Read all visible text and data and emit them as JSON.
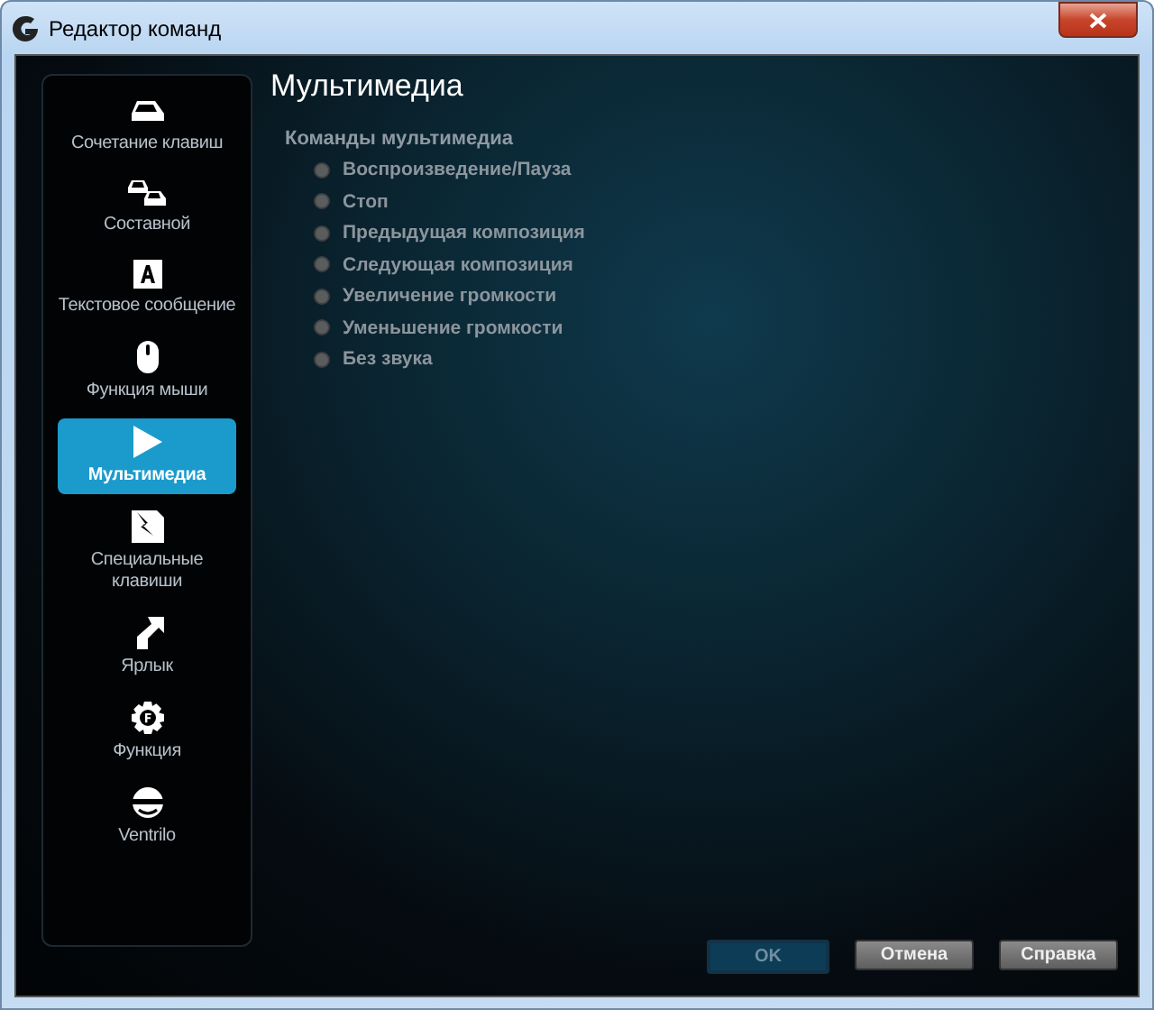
{
  "window": {
    "title": "Редактор команд"
  },
  "sidebar": {
    "items": [
      {
        "label": "Сочетание клавиш",
        "selected": false
      },
      {
        "label": "Составной",
        "selected": false
      },
      {
        "label": "Текстовое сообщение",
        "selected": false
      },
      {
        "label": "Функция мыши",
        "selected": false
      },
      {
        "label": "Мультимедиа",
        "selected": true
      },
      {
        "label": "Специальные клавиши",
        "selected": false
      },
      {
        "label": "Ярлык",
        "selected": false
      },
      {
        "label": "Функция",
        "selected": false
      },
      {
        "label": "Ventrilo",
        "selected": false
      }
    ]
  },
  "content": {
    "heading": "Мультимедиа",
    "group_label": "Команды мультимедиа",
    "options": [
      {
        "label": "Воспроизведение/Пауза",
        "selected": false
      },
      {
        "label": "Стоп",
        "selected": false
      },
      {
        "label": "Предыдущая композиция",
        "selected": false
      },
      {
        "label": "Следующая композиция",
        "selected": false
      },
      {
        "label": "Увеличение громкости",
        "selected": false
      },
      {
        "label": "Уменьшение громкости",
        "selected": false
      },
      {
        "label": "Без звука",
        "selected": false
      }
    ]
  },
  "buttons": [
    {
      "label": "OK",
      "disabled": true
    },
    {
      "label": "Отмена",
      "disabled": false
    },
    {
      "label": "Справка",
      "disabled": false
    }
  ]
}
